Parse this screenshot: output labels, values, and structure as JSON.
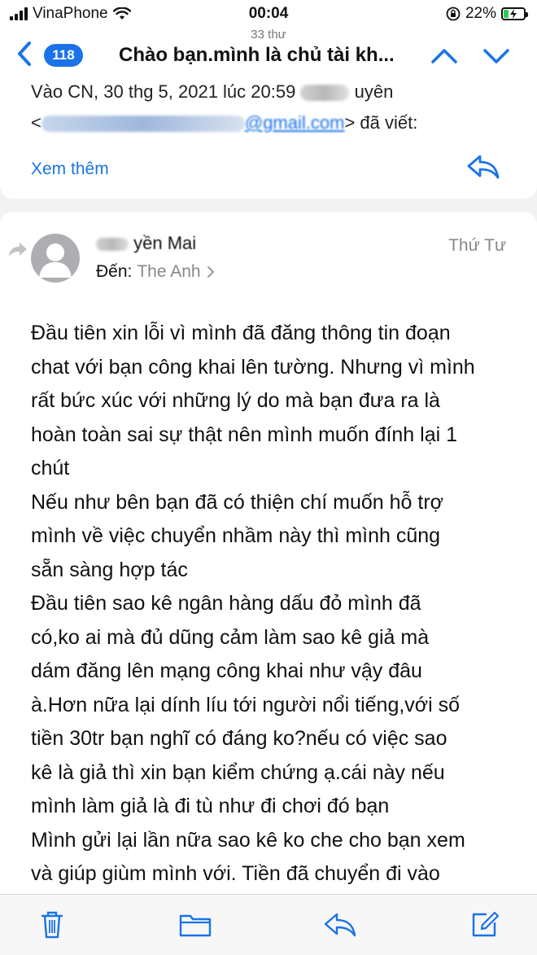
{
  "status_bar": {
    "carrier": "VinaPhone",
    "time": "00:04",
    "battery_percent": "22%",
    "battery_level": 0.22,
    "icons": [
      "signal-icon",
      "wifi-icon",
      "orientation-lock-icon",
      "battery-icon"
    ]
  },
  "nav": {
    "message_count": "33 thư",
    "badge": "118",
    "title": "Chào bạn.mình là chủ tài kh...",
    "icons": [
      "back-chevron-icon",
      "chevron-up-icon",
      "chevron-down-icon"
    ]
  },
  "previous_message": {
    "quote_prefix": "Vào CN, 30 thg 5, 2021 lúc 20:59",
    "sender_partial": "uyên",
    "email_open": "<",
    "email_domain_visible": "@gmail.com",
    "wrote": "> đã viết:",
    "show_more": "Xem thêm"
  },
  "message": {
    "sender_visible": "yền Mai",
    "to_label": "Đến:",
    "to_name": "The Anh",
    "date": "Thứ Tư",
    "body_lines": [
      "Đầu tiên xin lỗi vì mình đã đăng thông tin đoạn",
      "chat với bạn công khai lên tường. Nhưng vì mình",
      "rất bức xúc với những lý do mà bạn đưa ra là",
      "hoàn toàn sai sự thật nên mình muốn đính lại 1",
      "chút",
      "Nếu như bên bạn đã có thiện chí muốn hỗ trợ",
      "mình về việc chuyển nhầm này thì mình cũng",
      "sẵn sàng hợp tác",
      "Đầu tiên sao kê ngân hàng dấu đỏ mình đã",
      "có,ko ai mà đủ dũng cảm làm sao kê giả mà",
      "dám đăng lên mạng công khai như vậy đâu",
      "à.Hơn nữa lại dính líu tới người nổi tiếng,với số",
      "tiền 30tr bạn nghĩ có đáng ko?nếu có việc sao",
      "kê là giả thì xin bạn kiểm chứng ạ.cái này nếu",
      "mình làm giả là đi tù như đi chơi đó bạn",
      "Mình gửi lại lần nữa sao kê ko che cho bạn xem",
      "và giúp giùm mình với. Tiền đã chuyển đi vào"
    ]
  },
  "toolbar": {
    "icons": [
      "trash-icon",
      "folder-icon",
      "reply-icon",
      "compose-icon"
    ]
  },
  "colors": {
    "accent": "#1a73e8",
    "battery_fill": "#34c759",
    "secondary_text": "#888888"
  }
}
